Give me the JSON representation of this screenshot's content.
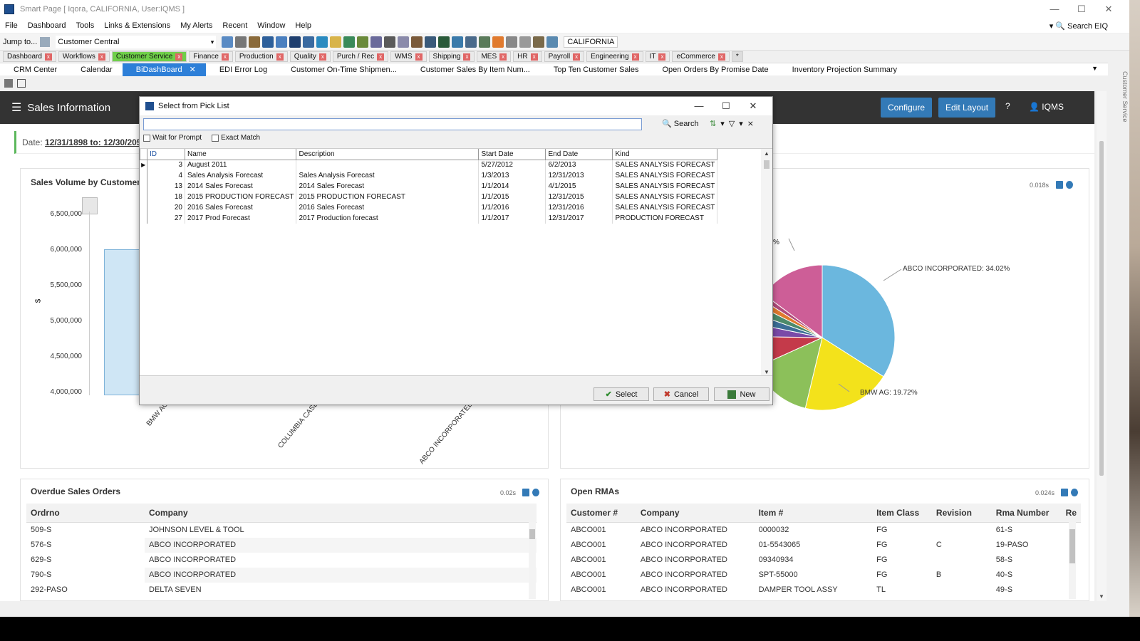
{
  "window": {
    "title": "Smart Page [ Iqora, CALIFORNIA, User:IQMS ]"
  },
  "menu": {
    "items": [
      "File",
      "Dashboard",
      "Tools",
      "Links & Extensions",
      "My Alerts",
      "Recent",
      "Window",
      "Help"
    ],
    "search_label": "Search EIQ"
  },
  "toolbar": {
    "jump_label": "Jump to...",
    "combo_value": "Customer Central",
    "location": "CALIFORNIA"
  },
  "module_tabs": [
    "Dashboard",
    "Workflows",
    "Customer Service",
    "Finance",
    "Production",
    "Quality",
    "Purch / Rec",
    "WMS",
    "Shipping",
    "MES",
    "HR",
    "Payroll",
    "Engineering",
    "IT",
    "eCommerce"
  ],
  "module_tab_plus": "*",
  "sub_tabs": [
    "CRM Center",
    "Calendar",
    "BiDashBoard",
    "EDI Error Log",
    "Customer On-Time Shipmen...",
    "Customer Sales By Item Num...",
    "Top Ten Customer Sales",
    "Open Orders By Promise Date",
    "Inventory Projection Summary"
  ],
  "side_label": "Customer Service",
  "page": {
    "title": "Sales Information",
    "configure_label": "Configure",
    "edit_layout_label": "Edit Layout",
    "user_label": "IQMS",
    "date_prefix": "Date:",
    "date_range": "12/31/1898 to: 12/30/205"
  },
  "sales_volume": {
    "title": "Sales Volume by Customer",
    "y_ticks": [
      "6,500,000",
      "6,000,000",
      "5,500,000",
      "5,000,000",
      "4,500,000",
      "4,000,000"
    ],
    "y_axis_symbol": "$",
    "x_labels": [
      "BMW AG",
      "COLUMBIA CASE",
      "ABCO INCORPORATED"
    ]
  },
  "pie_panel": {
    "timing": "0.018s",
    "partial_label": "%",
    "label_abco": "ABCO INCORPORATED: 34.02%",
    "label_bmw": "BMW AG: 19.72%"
  },
  "chart_data": {
    "type": "pie",
    "title": "",
    "slices": [
      {
        "label": "ABCO INCORPORATED",
        "value": 34.02,
        "color": "#6bb7de"
      },
      {
        "label": "BMW AG",
        "value": 19.72,
        "color": "#f3e21b"
      },
      {
        "label": "",
        "value": 14.5,
        "color": "#8cc05a"
      },
      {
        "label": "",
        "value": 7.0,
        "color": "#c43a4a"
      },
      {
        "label": "",
        "value": 3.0,
        "color": "#7a4aa8"
      },
      {
        "label": "",
        "value": 2.2,
        "color": "#3c6e96"
      },
      {
        "label": "",
        "value": 2.0,
        "color": "#4c8a6a"
      },
      {
        "label": "",
        "value": 1.5,
        "color": "#e07a2e"
      },
      {
        "label": "",
        "value": 1.2,
        "color": "#b04a7a"
      },
      {
        "label": "",
        "value": 14.86,
        "color": "#cd5e97"
      }
    ]
  },
  "overdue": {
    "title": "Overdue Sales Orders",
    "timing": "0.02s",
    "columns": [
      "Ordrno",
      "Company"
    ],
    "rows": [
      [
        "509-S",
        "JOHNSON LEVEL & TOOL"
      ],
      [
        "576-S",
        "ABCO INCORPORATED"
      ],
      [
        "629-S",
        "ABCO INCORPORATED"
      ],
      [
        "790-S",
        "ABCO INCORPORATED"
      ],
      [
        "292-PASO",
        "DELTA SEVEN"
      ]
    ]
  },
  "rmas": {
    "title": "Open RMAs",
    "timing": "0.024s",
    "columns": [
      "Customer #",
      "Company",
      "Item #",
      "Item Class",
      "Revision",
      "Rma Number",
      "Re"
    ],
    "rows": [
      [
        "ABCO001",
        "ABCO INCORPORATED",
        "0000032",
        "FG",
        "",
        "61-S"
      ],
      [
        "ABCO001",
        "ABCO INCORPORATED",
        "01-5543065",
        "FG",
        "C",
        "19-PASO"
      ],
      [
        "ABCO001",
        "ABCO INCORPORATED",
        "09340934",
        "FG",
        "",
        "58-S"
      ],
      [
        "ABCO001",
        "ABCO INCORPORATED",
        "SPT-55000",
        "FG",
        "B",
        "40-S"
      ],
      [
        "ABCO001",
        "ABCO INCORPORATED",
        "DAMPER TOOL ASSY",
        "TL",
        "",
        "49-S"
      ]
    ]
  },
  "dialog": {
    "title": "Select from Pick List",
    "search_label": "Search",
    "wait_label": "Wait for Prompt",
    "exact_label": "Exact Match",
    "columns": [
      "ID",
      "Name",
      "Description",
      "Start Date",
      "End Date",
      "Kind"
    ],
    "rows": [
      [
        "3",
        "August 2011",
        "",
        "5/27/2012",
        "6/2/2013",
        "SALES ANALYSIS FORECAST"
      ],
      [
        "4",
        "Sales Analysis Forecast",
        "Sales Analysis Forecast",
        "1/3/2013",
        "12/31/2013",
        "SALES ANALYSIS FORECAST"
      ],
      [
        "13",
        "2014 Sales Forecast",
        "2014 Sales Forecast",
        "1/1/2014",
        "4/1/2015",
        "SALES ANALYSIS FORECAST"
      ],
      [
        "18",
        "2015 PRODUCTION FORECAST",
        "2015 PRODUCTION FORECAST",
        "1/1/2015",
        "12/31/2015",
        "SALES ANALYSIS FORECAST"
      ],
      [
        "20",
        "2016 Sales Forecast",
        "2016 Sales Forecast",
        "1/1/2016",
        "12/31/2016",
        "SALES ANALYSIS FORECAST"
      ],
      [
        "27",
        "2017 Prod Forecast",
        "2017 Production forecast",
        "1/1/2017",
        "12/31/2017",
        "PRODUCTION FORECAST"
      ]
    ],
    "select_label": "Select",
    "cancel_label": "Cancel",
    "new_label": "New"
  }
}
